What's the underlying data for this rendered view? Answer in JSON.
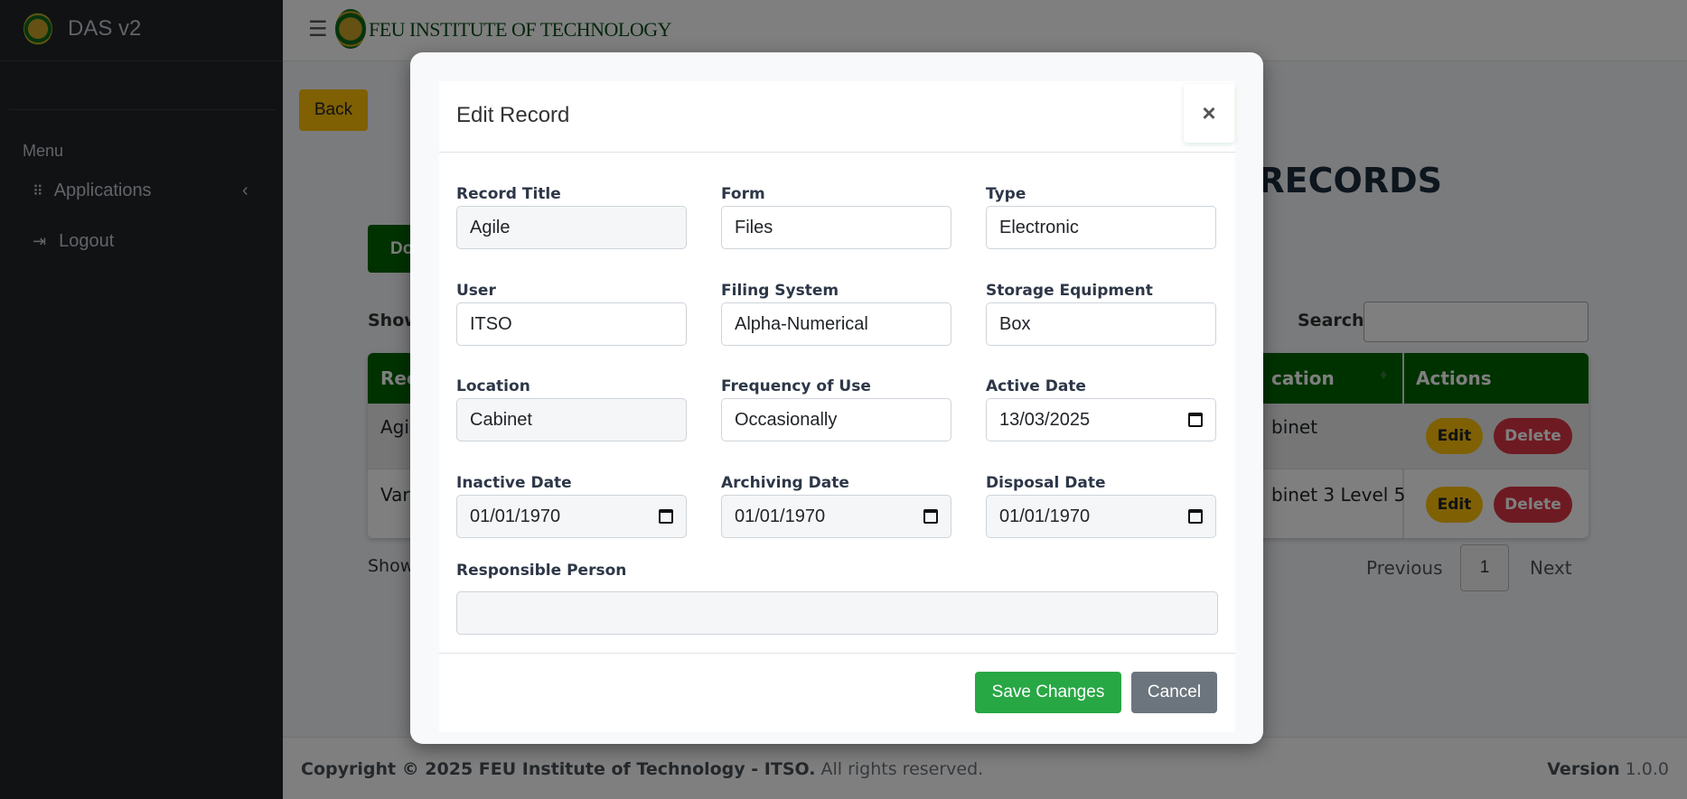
{
  "sidebar": {
    "brand": "DAS v2",
    "menu_heading": "Menu",
    "items": [
      {
        "label": "Applications",
        "icon": "grid-icon"
      },
      {
        "label": "Logout",
        "icon": "logout-icon"
      }
    ]
  },
  "topbar": {
    "institution": "FEU INSTITUTE OF TECHNOLOGY"
  },
  "main": {
    "back_label": "Back",
    "title_fragment": "G RECORDS",
    "green_button_fragment": "Do",
    "show_fragment": "Show",
    "search_label": "Search:",
    "search_value": "",
    "table": {
      "headers": [
        "Rec",
        "cation",
        "Actions"
      ],
      "rows": [
        {
          "first": "Agil",
          "location": "binet"
        },
        {
          "first": "Var",
          "location": "binet 3 Level 5"
        }
      ],
      "edit_label": "Edit",
      "delete_label": "Delete"
    },
    "info_fragment": "Show",
    "pagination": {
      "previous": "Previous",
      "page": "1",
      "next": "Next"
    }
  },
  "modal": {
    "title": "Edit Record",
    "close": "×",
    "fields": [
      {
        "label": "Record Title",
        "value": "Agile",
        "readonly": true
      },
      {
        "label": "Form",
        "value": "Files"
      },
      {
        "label": "Type",
        "value": "Electronic"
      },
      {
        "label": "User",
        "value": "ITSO"
      },
      {
        "label": "Filing System",
        "value": "Alpha-Numerical"
      },
      {
        "label": "Storage Equipment",
        "value": "Box"
      },
      {
        "label": "Location",
        "value": "Cabinet",
        "readonly": true
      },
      {
        "label": "Frequency of Use",
        "value": "Occasionally"
      },
      {
        "label": "Active Date",
        "value": "13/03/2025",
        "date": true
      },
      {
        "label": "Inactive Date",
        "value": "01/01/1970",
        "date": true,
        "readonly": true
      },
      {
        "label": "Archiving Date",
        "value": "01/01/1970",
        "date": true,
        "readonly": true
      },
      {
        "label": "Disposal Date",
        "value": "01/01/1970",
        "date": true,
        "readonly": true
      }
    ],
    "responsible_label": "Responsible Person",
    "responsible_value": "",
    "save_label": "Save Changes",
    "cancel_label": "Cancel"
  },
  "footer": {
    "copyright": "Copyright © 2025 FEU Institute of Technology - ITSO.",
    "rights": "All rights reserved.",
    "version_label": "Version",
    "version": "1.0.0"
  },
  "colors": {
    "sidebar": "#212529",
    "table_header": "#006400",
    "save": "#28a745",
    "cancel": "#6c757d",
    "edit": "#ffc107",
    "delete": "#dc3545"
  }
}
